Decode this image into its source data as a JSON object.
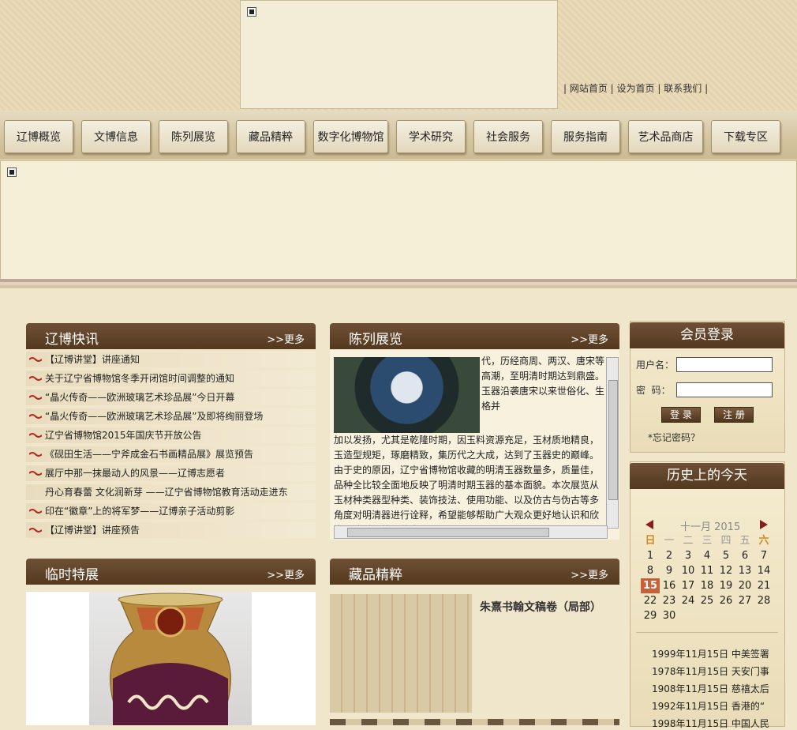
{
  "header": {
    "links": [
      "| 网站首页 |",
      "设为首页",
      "|",
      "联系我们",
      "|"
    ]
  },
  "nav": [
    "辽博概览",
    "文博信息",
    "陈列展览",
    "藏品精粹",
    "数字化博物馆",
    "学术研究",
    "社会服务",
    "服务指南",
    "艺术品商店",
    "下载专区"
  ],
  "news": {
    "title": "辽博快讯",
    "more": ">>更多",
    "items": [
      "【辽博讲堂】讲座通知",
      "关于辽宁省博物馆冬季开闭馆时间调整的通知",
      "“晶火传奇——欧洲玻璃艺术珍品展”今日开幕",
      "“晶火传奇——欧洲玻璃艺术珍品展”及即将绚丽登场",
      "辽宁省博物馆2015年国庆节开放公告",
      "《砚田生活——宁斧成金石书画精品展》展览预告",
      "展厅中那一抹最动人的风景——辽博志愿者",
      "丹心育春蕾 文化润新芽 ——辽宁省博物馆教育活动走进东",
      "印在“徽章”上的将军梦——辽博亲子活动剪影",
      "【辽博讲堂】讲座预告"
    ]
  },
  "exhibition": {
    "title": "陈列展览",
    "more": ">>更多",
    "text_top": [
      "代，历经商周、两汉、唐宋等",
      "高潮，至明清时期达到鼎盛。",
      "玉器沿袭唐宋以来世俗化、生",
      "格并"
    ],
    "text_body": "加以发扬，尤其是乾隆时期，因玉料资源充足，玉材质地精良，玉造型规矩，琢磨精致，集历代之大成，达到了玉器史的巅峰。由于史的原因，辽宁省博物馆收藏的明清玉器数量多，质量佳，品种全比较全面地反映了明清时期玉器的基本面貌。本次展览从玉材种类器型种类、装饰技法、使用功能、以及仿古与伪古等多角度对明清器进行诠释，希望能够帮助广大观众更好地认识和欣赏明清时期的器艺术。"
  },
  "temporary": {
    "title": "临时特展",
    "more": ">>更多"
  },
  "collection": {
    "title": "藏品精粹",
    "more": ">>更多",
    "caption": "朱熹书翰文稿卷（局部）"
  },
  "login": {
    "title": "会员登录",
    "username_label": "用户名：",
    "password_label": "密  码：",
    "login_button": "登 录",
    "register_button": "注 册",
    "forgot": "*忘记密码？"
  },
  "history": {
    "title": "历史上的今天",
    "month": "十一月 2015",
    "weekdays": [
      "日",
      "一",
      "二",
      "三",
      "四",
      "五",
      "六"
    ],
    "days": [
      [
        "",
        "",
        "",
        "",
        "",
        "",
        ""
      ],
      [
        "1",
        "2",
        "3",
        "4",
        "5",
        "6",
        "7"
      ],
      [
        "8",
        "9",
        "10",
        "11",
        "12",
        "13",
        "14"
      ],
      [
        "15",
        "16",
        "17",
        "18",
        "19",
        "20",
        "21"
      ],
      [
        "22",
        "23",
        "24",
        "25",
        "26",
        "27",
        "28"
      ],
      [
        "29",
        "30",
        "",
        "",
        "",
        "",
        ""
      ]
    ],
    "today": "15",
    "events": [
      "1999年11月15日 中美签署",
      "1978年11月15日 天安门事",
      "1908年11月15日 慈禧太后",
      "1992年11月15日 香港的“",
      "1998年11月15日 中国人民"
    ]
  }
}
